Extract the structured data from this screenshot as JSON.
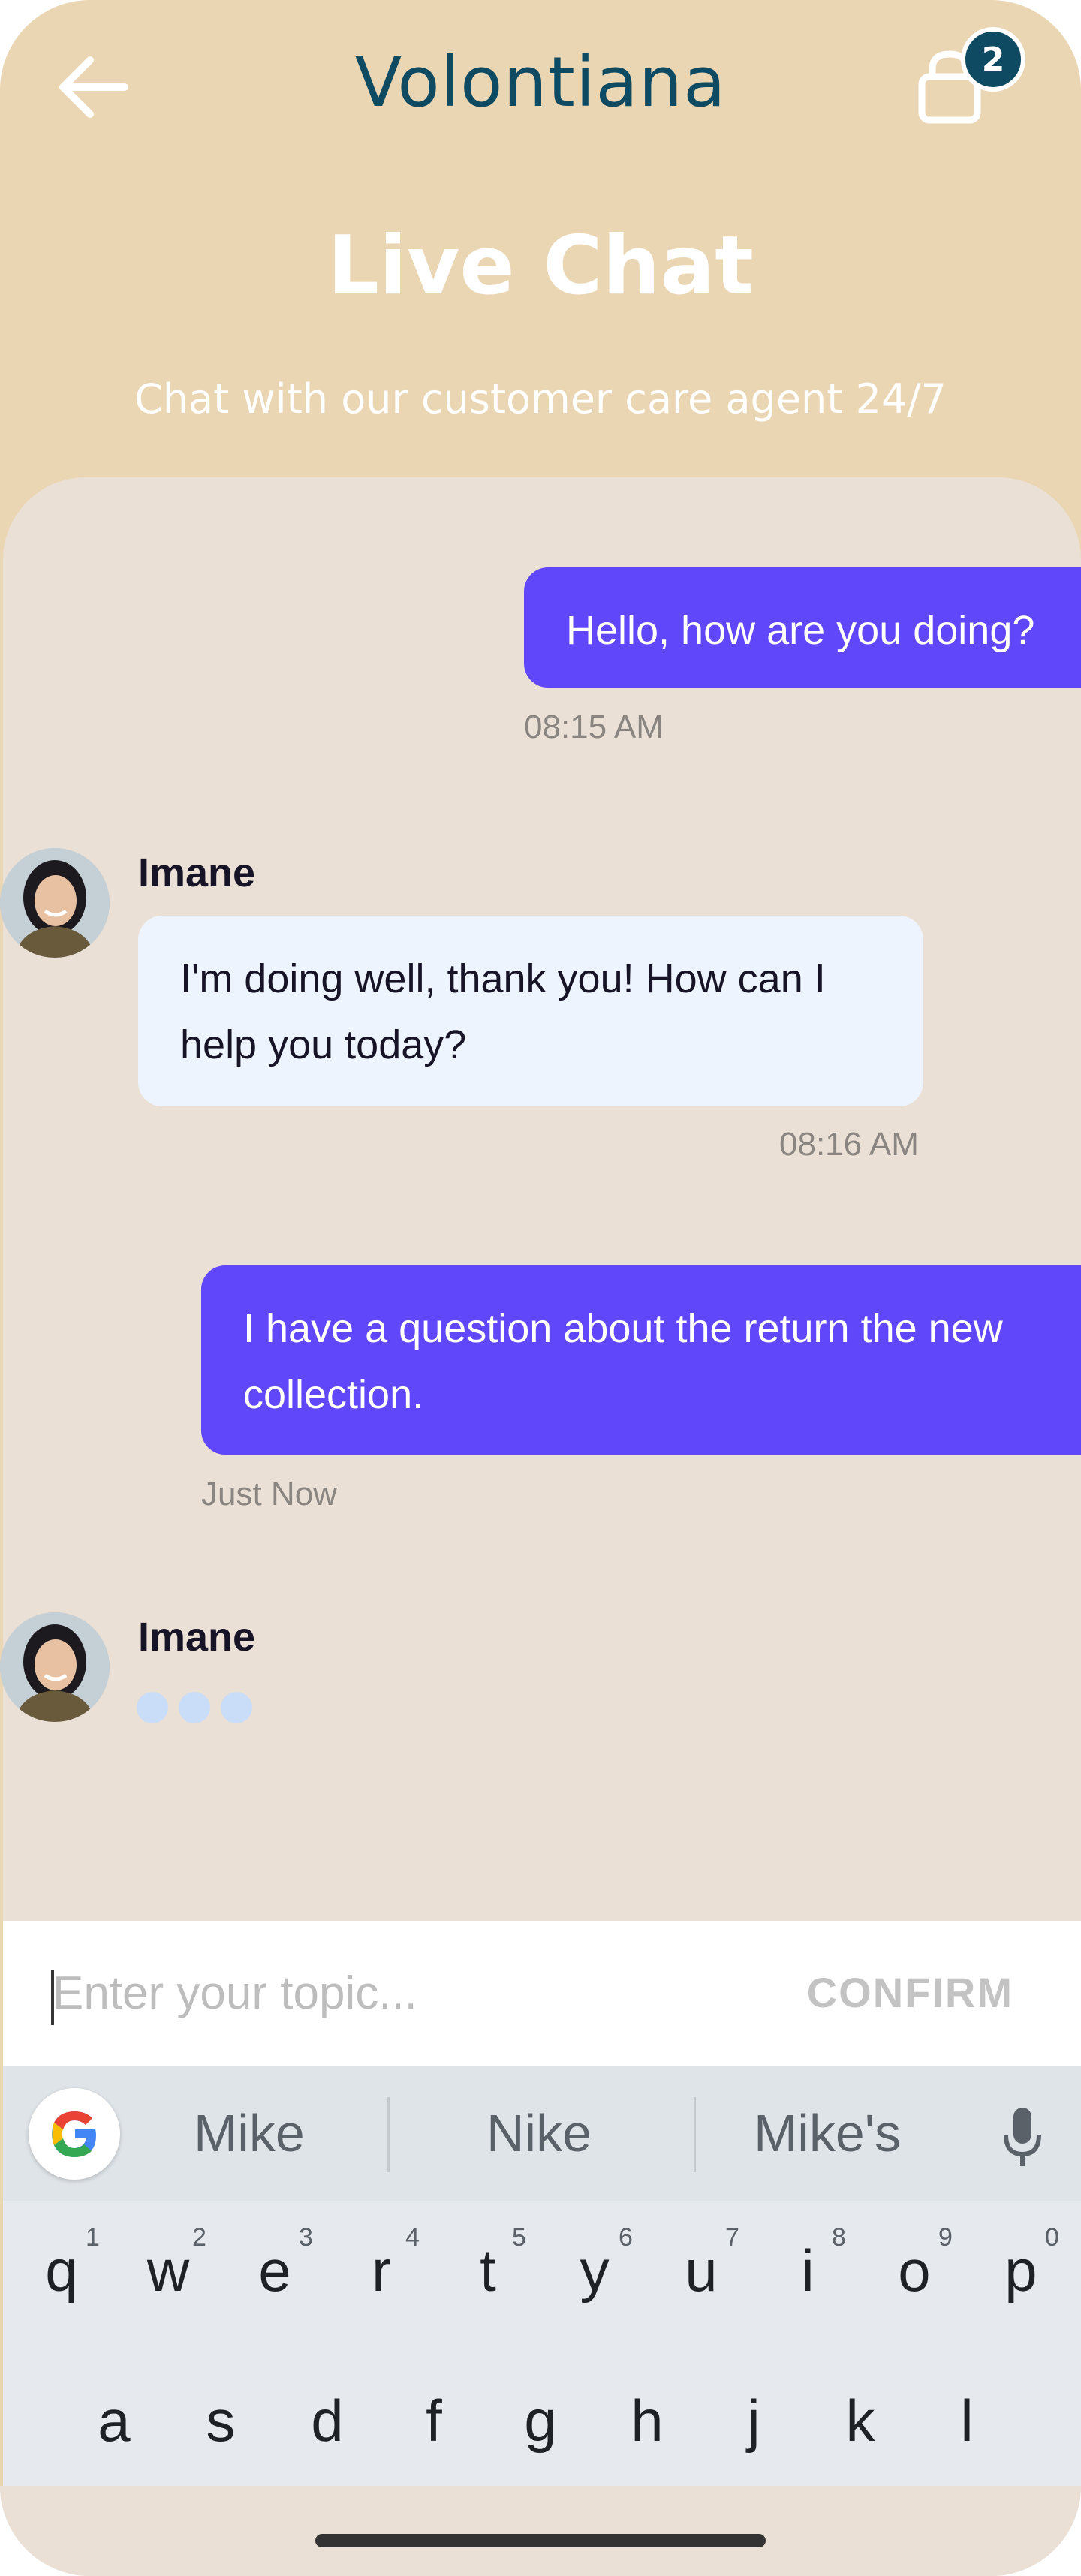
{
  "header": {
    "brand": "Volontiana",
    "cart_count": "2",
    "title": "Live Chat",
    "subtitle": "Chat with our customer care agent 24/7"
  },
  "messages": [
    {
      "direction": "out",
      "text": "Hello, how are you doing?",
      "time": "08:15 AM"
    },
    {
      "direction": "in",
      "sender": "Imane",
      "text_line1": "I'm doing well, thank you! How can I",
      "text_line2": "help you today?",
      "time": "08:16 AM"
    },
    {
      "direction": "out",
      "text_line1": "I have a question about the return the new",
      "text_line2": "collection.",
      "time": "Just Now"
    },
    {
      "direction": "in",
      "sender": "Imane",
      "typing": true
    }
  ],
  "input": {
    "placeholder": "Enter your topic...",
    "confirm_label": "CONFIRM"
  },
  "keyboard": {
    "suggestions": [
      "Mike",
      "Nike",
      "Mike's"
    ],
    "row1": [
      "q",
      "w",
      "e",
      "r",
      "t",
      "y",
      "u",
      "i",
      "o",
      "p"
    ],
    "row1_numbers": [
      "1",
      "2",
      "3",
      "4",
      "5",
      "6",
      "7",
      "8",
      "9",
      "0"
    ],
    "row2": [
      "a",
      "s",
      "d",
      "f",
      "g",
      "h",
      "j",
      "k",
      "l"
    ]
  },
  "colors": {
    "header_bg": "#ead6b3",
    "brand": "#0f4a63",
    "outgoing_bubble": "#6147fa",
    "incoming_bubble": "#eef4fd",
    "chat_bg": "#eae0d5"
  },
  "icons": {
    "back": "arrow-left-icon",
    "cart": "shopping-bag-icon",
    "mic": "microphone-icon",
    "google": "google-icon"
  }
}
